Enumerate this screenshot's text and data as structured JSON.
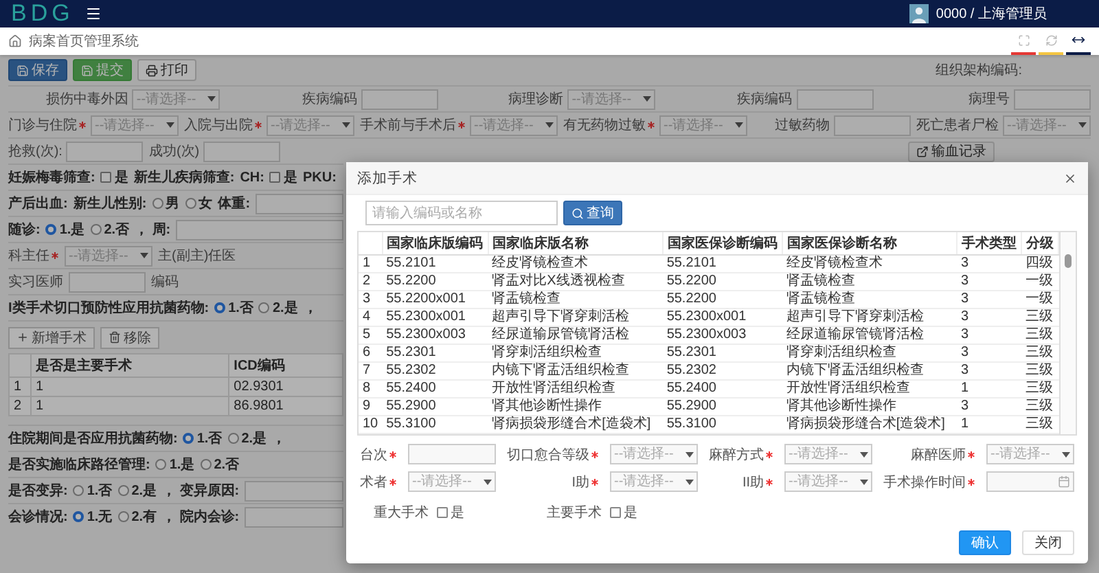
{
  "header": {
    "logo": "BDG",
    "user": "0000 / 上海管理员"
  },
  "breadcrumb": {
    "title": "病案首页管理系统"
  },
  "toolbar": {
    "buttons": [
      {
        "label": "保存",
        "kind": "primary"
      },
      {
        "label": "提交",
        "kind": "success"
      },
      {
        "label": "打印",
        "kind": "default"
      }
    ],
    "org_code_label": "组织架构编码:"
  },
  "top_rows": [
    {
      "fields": [
        {
          "label": "损伤中毒外因",
          "required": false,
          "kind": "select",
          "placeholder": "--请选择--"
        },
        {
          "label": "疾病编码",
          "required": false,
          "kind": "input"
        },
        {
          "label": "病理诊断",
          "required": false,
          "kind": "select",
          "placeholder": "--请选择--"
        },
        {
          "label": "疾病编码",
          "required": false,
          "kind": "input"
        },
        {
          "label": "病理号",
          "required": false,
          "kind": "input"
        }
      ]
    },
    {
      "fields": [
        {
          "label": "门诊与住院",
          "required": true,
          "kind": "select",
          "placeholder": "--请选择--"
        },
        {
          "label": "入院与出院",
          "required": true,
          "kind": "select",
          "placeholder": "--请选择--"
        },
        {
          "label": "手术前与手术后",
          "required": true,
          "kind": "select",
          "placeholder": "--请选择--"
        },
        {
          "label": "有无药物过敏",
          "required": true,
          "kind": "select",
          "placeholder": "--请选择--"
        },
        {
          "label": "过敏药物",
          "required": false,
          "kind": "input"
        },
        {
          "label": "死亡患者尸检",
          "required": false,
          "kind": "select",
          "placeholder": "--请选择--"
        }
      ]
    },
    {
      "fields": [
        {
          "label": "抢救(次):",
          "required": false,
          "kind": "input"
        },
        {
          "label": "成功(次)",
          "required": false,
          "kind": "input"
        }
      ],
      "button": "输血记录"
    }
  ],
  "form_rows_a": [
    {
      "items": [
        {
          "kind": "text",
          "text": "妊娠梅毒筛查:",
          "bold": true
        },
        {
          "kind": "checkbox",
          "label": "是",
          "checked": false
        },
        {
          "kind": "text",
          "text": "新生儿疾病筛查:",
          "bold": true
        },
        {
          "kind": "text",
          "text": "CH:",
          "bold": true
        },
        {
          "kind": "checkbox",
          "label": "是",
          "checked": false
        },
        {
          "kind": "text",
          "text": "PKU:",
          "bold": true
        }
      ]
    },
    {
      "items": [
        {
          "kind": "text",
          "text": "产后出血:",
          "bold": true
        },
        {
          "kind": "text",
          "text": "新生儿性别:",
          "bold": true
        },
        {
          "kind": "radio",
          "label": "男",
          "selected": false
        },
        {
          "kind": "radio",
          "label": "女",
          "selected": false
        },
        {
          "kind": "text",
          "text": "体重:",
          "bold": true
        },
        {
          "kind": "input"
        }
      ]
    },
    {
      "items": [
        {
          "kind": "text",
          "text": "随诊:",
          "bold": true
        },
        {
          "kind": "radio",
          "label": "1.是",
          "selected": true
        },
        {
          "kind": "radio",
          "label": "2.否",
          "selected": false
        },
        {
          "kind": "text",
          "text": "， 周:",
          "bold": true
        },
        {
          "kind": "input"
        }
      ]
    },
    {
      "items": [
        {
          "kind": "select",
          "label": "科主任",
          "required": true,
          "placeholder": "--请选择--"
        },
        {
          "kind": "text",
          "text": "主(副主)任医",
          "bold": false
        }
      ]
    },
    {
      "items": [
        {
          "kind": "input",
          "label": "实习医师",
          "required": false
        },
        {
          "kind": "text",
          "text": "编码",
          "bold": false
        }
      ]
    },
    {
      "items": [
        {
          "kind": "text",
          "text": "I类手术切口预防性应用抗菌药物:",
          "bold": true
        },
        {
          "kind": "radio",
          "label": "1.否",
          "selected": true
        },
        {
          "kind": "radio",
          "label": "2.是",
          "selected": false
        },
        {
          "kind": "text",
          "text": "，",
          "bold": true
        }
      ]
    }
  ],
  "surgery_actions": [
    {
      "label": "新增手术",
      "kind": "add"
    },
    {
      "label": "移除",
      "kind": "remove"
    }
  ],
  "surgery_table": {
    "columns": [
      "是否是主要手术",
      "ICD编码"
    ],
    "rows": [
      {
        "index": "1",
        "cells": [
          "1",
          "02.9301"
        ]
      },
      {
        "index": "2",
        "cells": [
          "1",
          "86.9801"
        ]
      }
    ]
  },
  "form_rows_b": [
    {
      "items": [
        {
          "kind": "text",
          "text": "住院期间是否应用抗菌药物:",
          "bold": true
        },
        {
          "kind": "radio",
          "label": "1.否",
          "selected": true
        },
        {
          "kind": "radio",
          "label": "2.是",
          "selected": false
        },
        {
          "kind": "text",
          "text": "，",
          "bold": true
        }
      ]
    },
    {
      "items": [
        {
          "kind": "text",
          "text": "是否实施临床路径管理:",
          "bold": true
        },
        {
          "kind": "radio",
          "label": "1.是",
          "selected": false
        },
        {
          "kind": "radio",
          "label": "2.否",
          "selected": false
        }
      ]
    },
    {
      "items": [
        {
          "kind": "text",
          "text": "是否变异:",
          "bold": true
        },
        {
          "kind": "radio",
          "label": "1.否",
          "selected": false
        },
        {
          "kind": "radio",
          "label": "2.是",
          "selected": false
        },
        {
          "kind": "text",
          "text": "， 变异原因:",
          "bold": true
        },
        {
          "kind": "input"
        }
      ]
    },
    {
      "items": [
        {
          "kind": "text",
          "text": "会诊情况:",
          "bold": true
        },
        {
          "kind": "radio",
          "label": "1.无",
          "selected": true
        },
        {
          "kind": "radio",
          "label": "2.有",
          "selected": false
        },
        {
          "kind": "text",
          "text": "， 院内会诊:",
          "bold": true
        },
        {
          "kind": "input"
        }
      ]
    }
  ],
  "modal": {
    "title": "添加手术",
    "search": {
      "placeholder": "请输入编码或名称",
      "button": "查询"
    },
    "table": {
      "columns": [
        "国家临床版编码",
        "国家临床版名称",
        "国家医保诊断编码",
        "国家医保诊断名称",
        "手术类型",
        "分级"
      ],
      "rows": [
        {
          "index": "1",
          "cells": [
            "55.2101",
            "经皮肾镜检查术",
            "55.2101",
            "经皮肾镜检查术",
            "3",
            "四级"
          ]
        },
        {
          "index": "2",
          "cells": [
            "55.2200",
            "肾盂对比X线透视检查",
            "55.2200",
            "肾盂镜检查",
            "3",
            "一级"
          ]
        },
        {
          "index": "3",
          "cells": [
            "55.2200x001",
            "肾盂镜检查",
            "55.2200",
            "肾盂镜检查",
            "3",
            "一级"
          ]
        },
        {
          "index": "4",
          "cells": [
            "55.2300x001",
            "超声引导下肾穿刺活检",
            "55.2300x001",
            "超声引导下肾穿刺活检",
            "3",
            "三级"
          ]
        },
        {
          "index": "5",
          "cells": [
            "55.2300x003",
            "经尿道输尿管镜肾活检",
            "55.2300x003",
            "经尿道输尿管镜肾活检",
            "3",
            "三级"
          ]
        },
        {
          "index": "6",
          "cells": [
            "55.2301",
            "肾穿刺活组织检查",
            "55.2301",
            "肾穿刺活组织检查",
            "3",
            "三级"
          ]
        },
        {
          "index": "7",
          "cells": [
            "55.2302",
            "内镜下肾盂活组织检查",
            "55.2302",
            "内镜下肾盂活组织检查",
            "3",
            "三级"
          ]
        },
        {
          "index": "8",
          "cells": [
            "55.2400",
            "开放性肾活组织检查",
            "55.2400",
            "开放性肾活组织检查",
            "1",
            "三级"
          ]
        },
        {
          "index": "9",
          "cells": [
            "55.2900",
            "肾其他诊断性操作",
            "55.2900",
            "肾其他诊断性操作",
            "3",
            "三级"
          ]
        },
        {
          "index": "10",
          "cells": [
            "55.3100",
            "肾病损袋形缝合术[造袋术]",
            "55.3100",
            "肾病损袋形缝合术[造袋术]",
            "1",
            "三级"
          ]
        }
      ]
    },
    "fields": [
      {
        "label": "台次",
        "required": true,
        "kind": "input"
      },
      {
        "label": "切口愈合等级",
        "required": true,
        "kind": "select",
        "placeholder": "--请选择--"
      },
      {
        "label": "麻醉方式",
        "required": true,
        "kind": "select",
        "placeholder": "--请选择--"
      },
      {
        "label": "麻醉医师",
        "required": true,
        "kind": "select",
        "placeholder": "--请选择--"
      },
      {
        "label": "术者",
        "required": true,
        "kind": "select",
        "placeholder": "--请选择--"
      },
      {
        "label": "I助",
        "required": true,
        "kind": "select",
        "placeholder": "--请选择--"
      },
      {
        "label": "II助",
        "required": true,
        "kind": "select",
        "placeholder": "--请选择--"
      },
      {
        "label": "手术操作时间",
        "required": true,
        "kind": "date"
      }
    ],
    "checkboxes": [
      {
        "label": "重大手术",
        "option": "是",
        "checked": false
      },
      {
        "label": "主要手术",
        "option": "是",
        "checked": false
      }
    ],
    "buttons": [
      {
        "label": "确认",
        "kind": "primary"
      },
      {
        "label": "关闭",
        "kind": "default"
      }
    ]
  }
}
